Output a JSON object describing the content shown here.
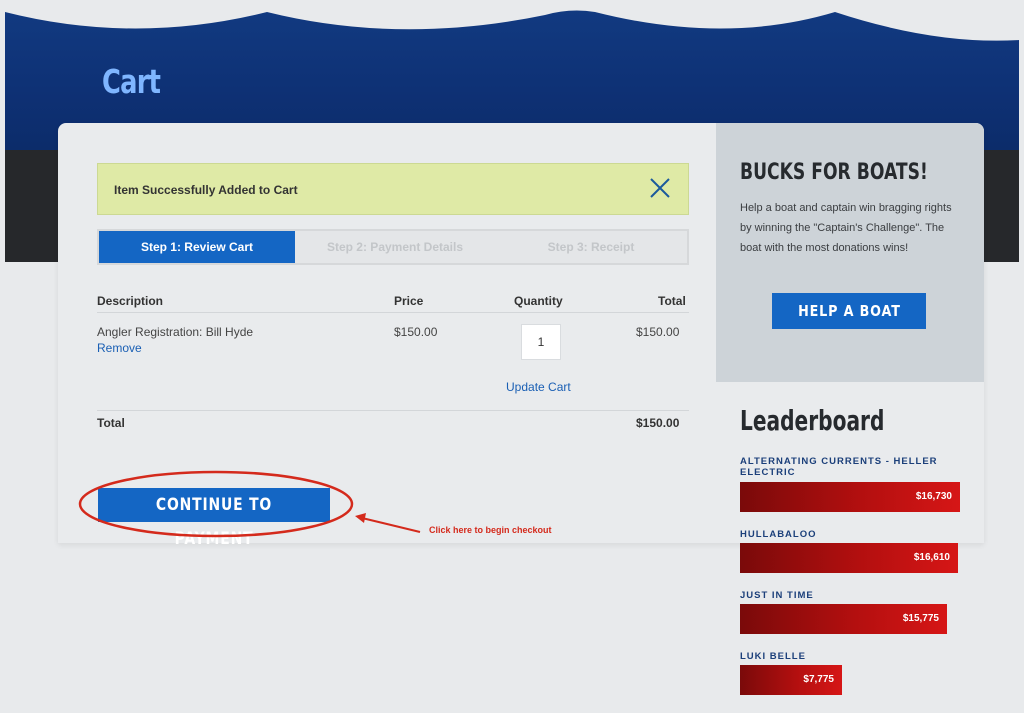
{
  "header": {
    "title": "Cart"
  },
  "alert": {
    "message": "Item Successfully Added to Cart",
    "close_icon": "close-x-icon"
  },
  "steps": [
    {
      "label": "Step 1: Review Cart",
      "active": true
    },
    {
      "label": "Step 2: Payment Details",
      "active": false
    },
    {
      "label": "Step 3: Receipt",
      "active": false
    }
  ],
  "cart": {
    "columns": {
      "description": "Description",
      "price": "Price",
      "quantity": "Quantity",
      "total": "Total"
    },
    "items": [
      {
        "description": "Angler Registration: Bill Hyde",
        "remove": "Remove",
        "price": "$150.00",
        "quantity": "1",
        "total": "$150.00"
      }
    ],
    "update_label": "Update Cart",
    "total_label": "Total",
    "total_value": "$150.00"
  },
  "actions": {
    "continue_label": "CONTINUE TO PAYMENT"
  },
  "annotation": {
    "text": "Click here to begin checkout",
    "color": "#d42a1c"
  },
  "promo": {
    "title": "BUCKS FOR BOATS!",
    "text": "Help a boat and captain win bragging rights by winning the \"Captain's Challenge\". The boat with the most donations wins!",
    "button": "HELP A BOAT"
  },
  "leaderboard": {
    "title": "Leaderboard",
    "entries": [
      {
        "name": "ALTERNATING CURRENTS - HELLER ELECTRIC",
        "amount": "$16,730",
        "value": 16730
      },
      {
        "name": "HULLABALOO",
        "amount": "$16,610",
        "value": 16610
      },
      {
        "name": "JUST IN TIME",
        "amount": "$15,775",
        "value": 15775
      },
      {
        "name": "LUKI BELLE",
        "amount": "$7,775",
        "value": 7775
      }
    ]
  },
  "colors": {
    "accent": "#1466c4",
    "header_blue": "#0e3175",
    "alert_bg": "#dfeaa6",
    "bar_red": "#b30f0f"
  }
}
